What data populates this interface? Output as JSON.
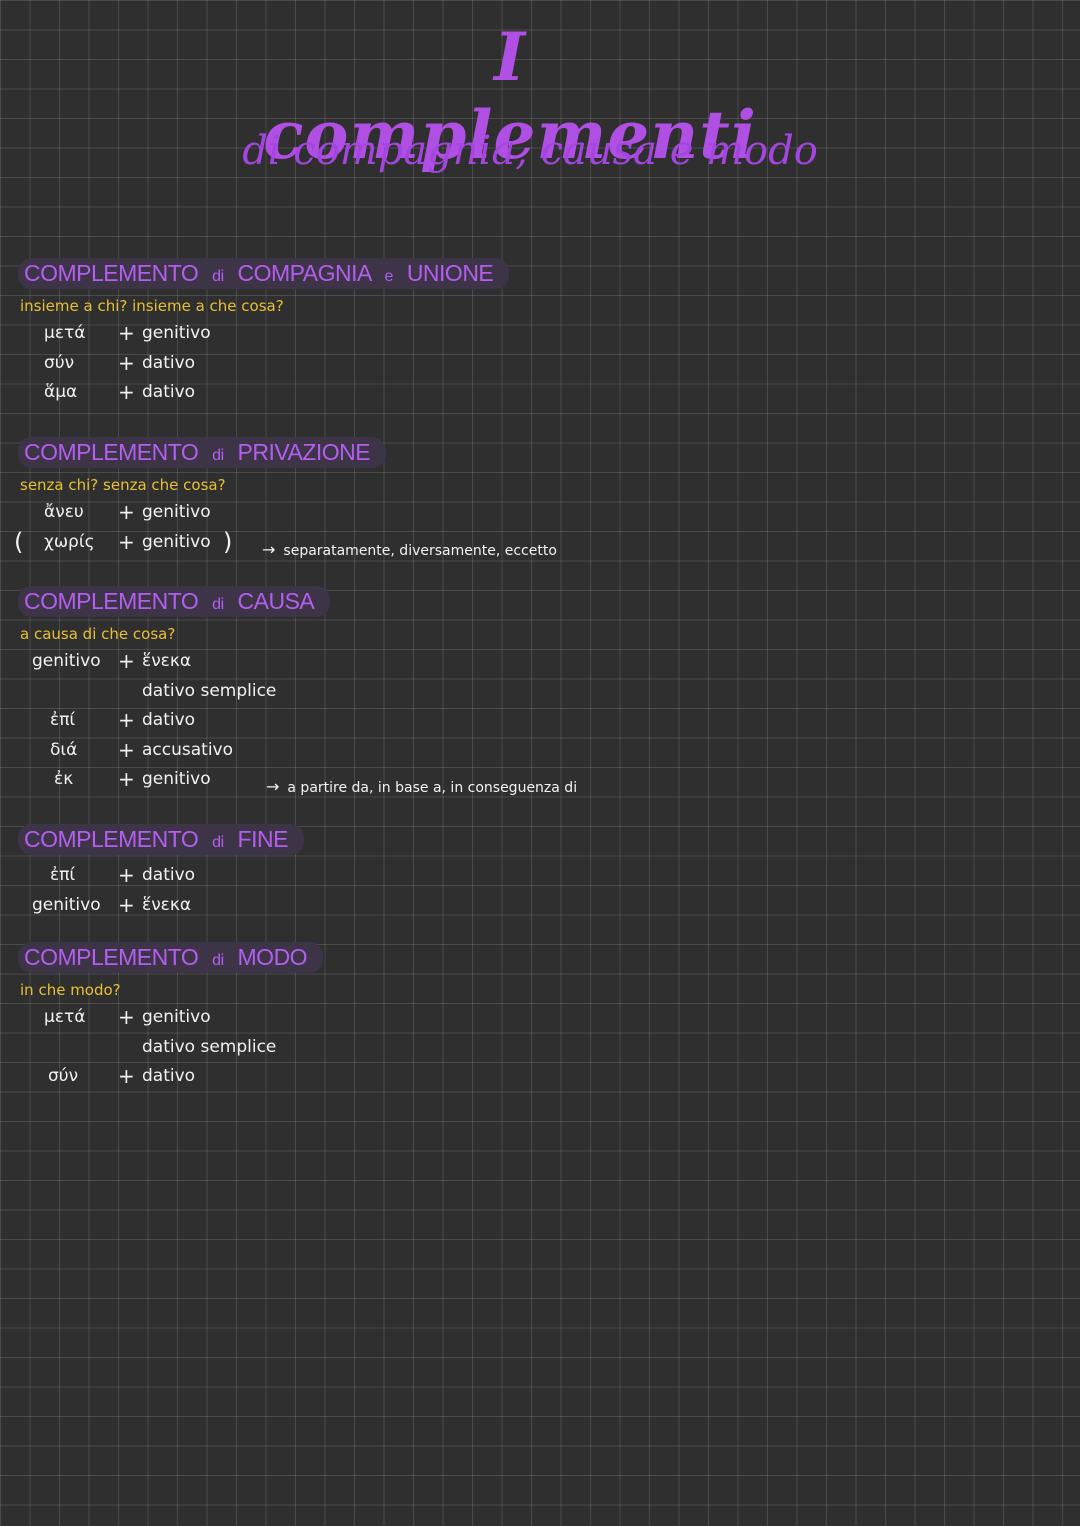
{
  "title": "I complementi",
  "subtitle": "di compagnia, causa e modo",
  "sections": {
    "compagnia": {
      "heading_a": "COMPLEMENTO",
      "heading_di": "di",
      "heading_b": "COMPAGNIA",
      "heading_e": "e",
      "heading_c": "UNIONE",
      "question": "insieme a chi? insieme a che cosa?",
      "rows": [
        {
          "prep": "μετά",
          "plus": "+",
          "case": "genitivo"
        },
        {
          "prep": "σύν",
          "plus": "+",
          "case": "dativo"
        },
        {
          "prep": "ἅμα",
          "plus": "+",
          "case": "dativo"
        }
      ]
    },
    "privazione": {
      "heading_a": "COMPLEMENTO",
      "heading_di": "di",
      "heading_b": "PRIVAZIONE",
      "question": "senza chi? senza che cosa?",
      "rows": [
        {
          "prep": "ἄνευ",
          "plus": "+",
          "case": "genitivo"
        },
        {
          "paren_l": "(",
          "prep": "χωρίς",
          "plus": "+",
          "case": "genitivo",
          "paren_r": ")"
        }
      ],
      "note": {
        "arrow": "→",
        "text": "separatamente, diversamente, eccetto"
      }
    },
    "causa": {
      "heading_a": "COMPLEMENTO",
      "heading_di": "di",
      "heading_b": "CAUSA",
      "question": "a causa di che cosa?",
      "rows": [
        {
          "prep": "genitivo",
          "plus": "+",
          "case": "ἕνεκα"
        },
        {
          "prep": "",
          "plus": "",
          "case": "dativo semplice"
        },
        {
          "prep": "ἐπί",
          "plus": "+",
          "case": "dativo"
        },
        {
          "prep": "διά",
          "plus": "+",
          "case": "accusativo"
        },
        {
          "prep": "ἐκ",
          "plus": "+",
          "case": "genitivo"
        }
      ],
      "note": {
        "arrow": "→",
        "text": "a partire da, in base a, in conseguenza di"
      }
    },
    "fine": {
      "heading_a": "COMPLEMENTO",
      "heading_di": "di",
      "heading_b": "FINE",
      "rows": [
        {
          "prep": "ἐπί",
          "plus": "+",
          "case": "dativo"
        },
        {
          "prep": "genitivo",
          "plus": "+",
          "case": "ἕνεκα"
        }
      ]
    },
    "modo": {
      "heading_a": "COMPLEMENTO",
      "heading_di": "di",
      "heading_b": "MODO",
      "question": "in che modo?",
      "rows": [
        {
          "prep": "μετά",
          "plus": "+",
          "case": "genitivo"
        },
        {
          "prep": "",
          "plus": "",
          "case": "dativo semplice"
        },
        {
          "prep": "σύν",
          "plus": "+",
          "case": "dativo"
        }
      ]
    }
  },
  "colors": {
    "background": "#2f2f2f",
    "accent_purple": "#b04fe3",
    "question_yellow": "#e7c034",
    "text": "#f2f2f2"
  }
}
